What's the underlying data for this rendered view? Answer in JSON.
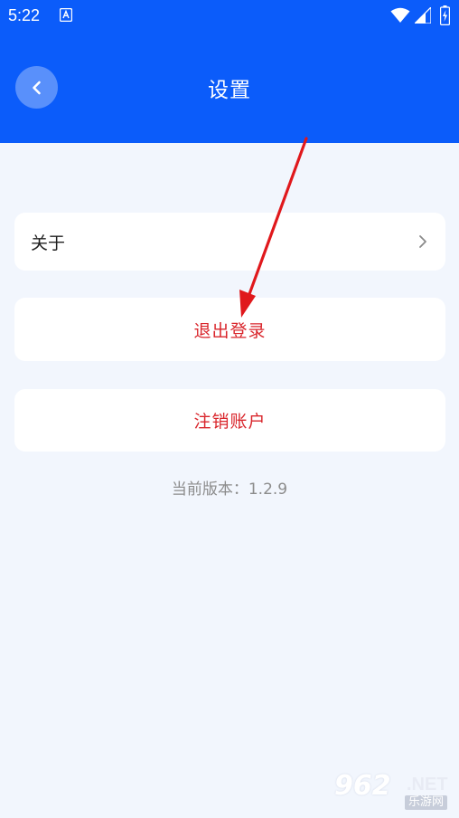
{
  "status_bar": {
    "time": "5:22",
    "icons": [
      "a-notification-icon",
      "wifi-icon",
      "signal-icon",
      "battery-icon"
    ]
  },
  "header": {
    "title": "设置",
    "back_icon": "chevron-left-icon",
    "background_color": "#0b5cfa"
  },
  "settings": {
    "about_label": "关于",
    "logout_label": "退出登录",
    "delete_account_label": "注销账户",
    "danger_color": "#d9262c"
  },
  "version": {
    "text": "当前版本：1.2.9"
  },
  "annotation": {
    "type": "red-arrow",
    "color": "#e0181c"
  },
  "watermark": {
    "logo": "962",
    "suffix": ".NET",
    "subtitle": "乐游网"
  }
}
